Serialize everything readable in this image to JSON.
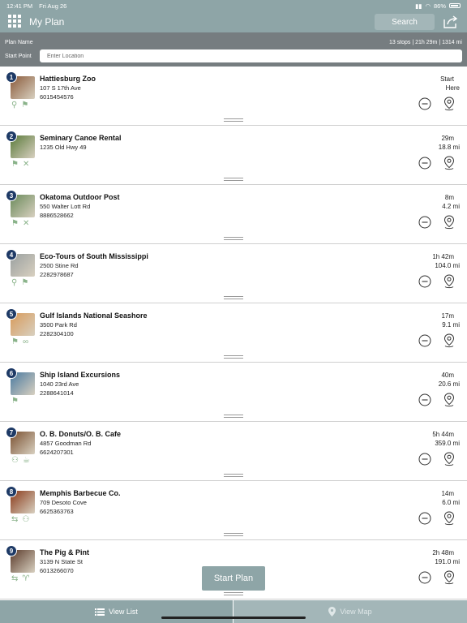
{
  "status_bar": {
    "time": "12:41 PM",
    "date": "Fri Aug 26",
    "battery": "86%"
  },
  "nav": {
    "title": "My Plan",
    "search_label": "Search",
    "icons": [
      "grid-menu-icon",
      "share-icon"
    ]
  },
  "plan": {
    "name_label": "Plan Name",
    "stats": "13 stops | 21h 29m | 1314 mi",
    "start_label": "Start Point",
    "start_placeholder": "Enter Location"
  },
  "stops": [
    {
      "number": "1",
      "name": "Hattiesburg Zoo",
      "address": "107 S 17th Ave",
      "phone": "6015454576",
      "time": "Start",
      "distance": "Here",
      "thumb_color": "#8a5a3a",
      "categories": [
        "map-pin-icon",
        "signpost-icon"
      ]
    },
    {
      "number": "2",
      "name": "Seminary Canoe Rental",
      "address": "1235 Old Hwy 49",
      "phone": "",
      "time": "29m",
      "distance": "18.8 mi",
      "thumb_color": "#5a7a3a",
      "categories": [
        "signpost-icon",
        "outdoor-tools-icon"
      ]
    },
    {
      "number": "3",
      "name": "Okatoma Outdoor Post",
      "address": "550 Walter Lott Rd",
      "phone": "8886528662",
      "time": "8m",
      "distance": "4.2 mi",
      "thumb_color": "#6a8a5a",
      "categories": [
        "signpost-icon",
        "outdoor-tools-icon"
      ]
    },
    {
      "number": "4",
      "name": "Eco-Tours of South Mississippi",
      "address": "2500 Stine Rd",
      "phone": "2282978687",
      "time": "1h 42m",
      "distance": "104.0 mi",
      "thumb_color": "#9aa0a0",
      "categories": [
        "map-pin-icon",
        "signpost-icon"
      ]
    },
    {
      "number": "5",
      "name": "Gulf Islands National Seashore",
      "address": "3500 Park Rd",
      "phone": "2282304100",
      "time": "17m",
      "distance": "9.1 mi",
      "thumb_color": "#d89a5a",
      "categories": [
        "signpost-icon",
        "binoculars-icon"
      ]
    },
    {
      "number": "6",
      "name": "Ship Island Excursions",
      "address": "1040 23rd Ave",
      "phone": "2288641014",
      "time": "40m",
      "distance": "20.6 mi",
      "thumb_color": "#4a7aa0",
      "categories": [
        "signpost-icon"
      ]
    },
    {
      "number": "7",
      "name": "O. B. Donuts/O. B. Cafe",
      "address": "4857 Goodman Rd",
      "phone": "6624207301",
      "time": "5h 44m",
      "distance": "359.0 mi",
      "thumb_color": "#7a5030",
      "categories": [
        "family-icon",
        "coffee-icon"
      ]
    },
    {
      "number": "8",
      "name": "Memphis Barbecue Co.",
      "address": "709 Desoto Cove",
      "phone": "6625363763",
      "time": "14m",
      "distance": "6.0 mi",
      "thumb_color": "#8a3a1a",
      "categories": [
        "car-icon",
        "family-icon"
      ]
    },
    {
      "number": "9",
      "name": "The Pig & Pint",
      "address": "3139 N State St",
      "phone": "6013266070",
      "time": "2h 48m",
      "distance": "191.0 mi",
      "thumb_color": "#5a3a2a",
      "categories": [
        "car-icon",
        "drink-icon"
      ]
    }
  ],
  "start_plan_label": "Start Plan",
  "tabs": {
    "list_label": "View List",
    "map_label": "View Map"
  },
  "colors": {
    "accent": "#8ea5a7",
    "header_dark": "#767d80",
    "badge": "#1e3a66",
    "category_icon": "#8ab38a"
  }
}
